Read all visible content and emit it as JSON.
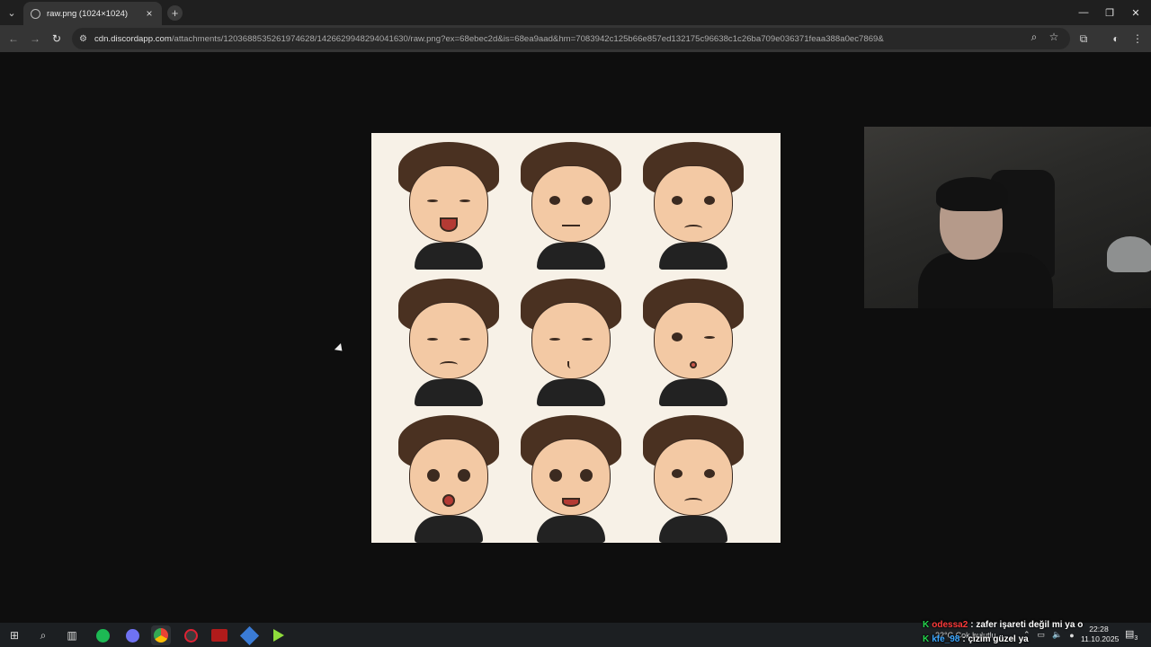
{
  "browser": {
    "tab": {
      "title": "raw.png (1024×1024)"
    },
    "new_tab_label": "+",
    "url": {
      "host": "cdn.discordapp.com",
      "path": "/attachments/1203688535261974628/1426629948294041630/raw.png?ex=68ebec2d&is=68ea9aad&hm=7083942c125b66e857ed132175c96638c1c26ba709e036371feaa388a0ec7869&"
    }
  },
  "taskbar": {
    "apps": [
      "start-icon",
      "search-icon",
      "task-view-icon",
      "spotify-icon",
      "discord-icon",
      "chrome-icon",
      "obs-icon",
      "voice-icon",
      "cube-icon",
      "play-icon"
    ],
    "weather": "22°C  Çok bulutlu",
    "clock": {
      "time": "22:28",
      "date": "11.10.2025"
    },
    "notifications": "3"
  },
  "chat": [
    {
      "user": "odessa2",
      "message": ": zafer işareti değil mi ya o"
    },
    {
      "user": "kfe_98",
      "message": ": çizim güzel ya"
    }
  ]
}
